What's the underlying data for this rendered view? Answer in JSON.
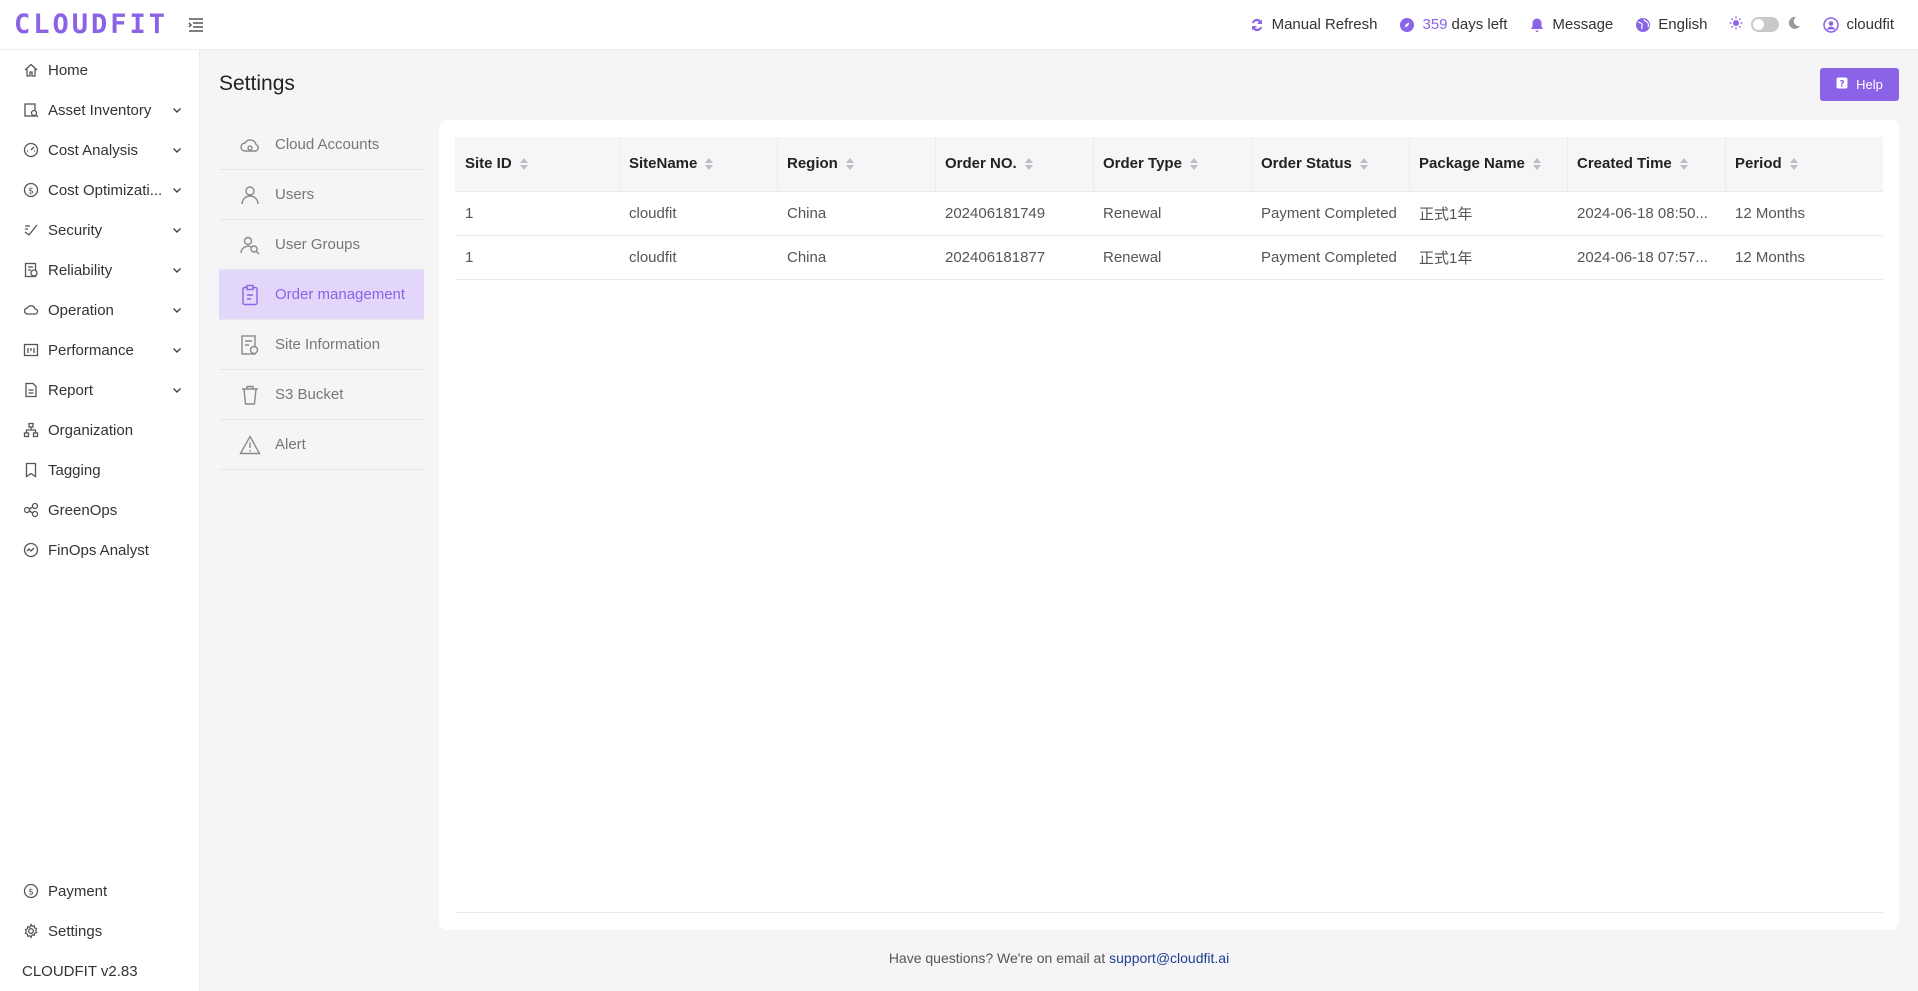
{
  "header": {
    "logo": "CLOUDFIT",
    "manual_refresh": "Manual Refresh",
    "days_left_count": "359",
    "days_left_label": "days left",
    "message": "Message",
    "language": "English",
    "user": "cloudfit"
  },
  "sidebar": {
    "items": [
      {
        "label": "Home",
        "icon": "home-icon",
        "expandable": false
      },
      {
        "label": "Asset Inventory",
        "icon": "asset-icon",
        "expandable": true
      },
      {
        "label": "Cost Analysis",
        "icon": "gauge-icon",
        "expandable": true
      },
      {
        "label": "Cost Optimizati...",
        "icon": "dollar-icon",
        "expandable": true
      },
      {
        "label": "Security",
        "icon": "security-icon",
        "expandable": true
      },
      {
        "label": "Reliability",
        "icon": "reliability-icon",
        "expandable": true
      },
      {
        "label": "Operation",
        "icon": "cloud-icon",
        "expandable": true
      },
      {
        "label": "Performance",
        "icon": "performance-icon",
        "expandable": true
      },
      {
        "label": "Report",
        "icon": "report-icon",
        "expandable": true
      },
      {
        "label": "Organization",
        "icon": "org-icon",
        "expandable": false
      },
      {
        "label": "Tagging",
        "icon": "tag-icon",
        "expandable": false
      },
      {
        "label": "GreenOps",
        "icon": "greenops-icon",
        "expandable": false
      },
      {
        "label": "FinOps Analyst",
        "icon": "finops-icon",
        "expandable": false
      }
    ],
    "payment": "Payment",
    "settings": "Settings",
    "version": "CLOUDFIT v2.83"
  },
  "page": {
    "title": "Settings",
    "help": "Help"
  },
  "settings_nav": {
    "items": [
      {
        "label": "Cloud Accounts",
        "icon": "cloud-account-icon"
      },
      {
        "label": "Users",
        "icon": "user-icon"
      },
      {
        "label": "User Groups",
        "icon": "user-group-icon"
      },
      {
        "label": "Order management",
        "icon": "clipboard-icon",
        "active": true
      },
      {
        "label": "Site Information",
        "icon": "site-info-icon"
      },
      {
        "label": "S3 Bucket",
        "icon": "bucket-icon"
      },
      {
        "label": "Alert",
        "icon": "alert-icon"
      }
    ]
  },
  "table": {
    "headers": [
      "Site ID",
      "SiteName",
      "Region",
      "Order NO.",
      "Order Type",
      "Order Status",
      "Package Name",
      "Created Time",
      "Period"
    ],
    "rows": [
      [
        "1",
        "cloudfit",
        "China",
        "202406181749",
        "Renewal",
        "Payment Completed",
        "正式1年",
        "2024-06-18 08:50...",
        "12 Months"
      ],
      [
        "1",
        "cloudfit",
        "China",
        "202406181877",
        "Renewal",
        "Payment Completed",
        "正式1年",
        "2024-06-18 07:57...",
        "12 Months"
      ]
    ]
  },
  "footer": {
    "text": "Have questions? We're on email at",
    "email": "support@cloudfit.ai"
  },
  "colors": {
    "accent": "#8b63e6",
    "active_bg": "#e2d7fa"
  }
}
